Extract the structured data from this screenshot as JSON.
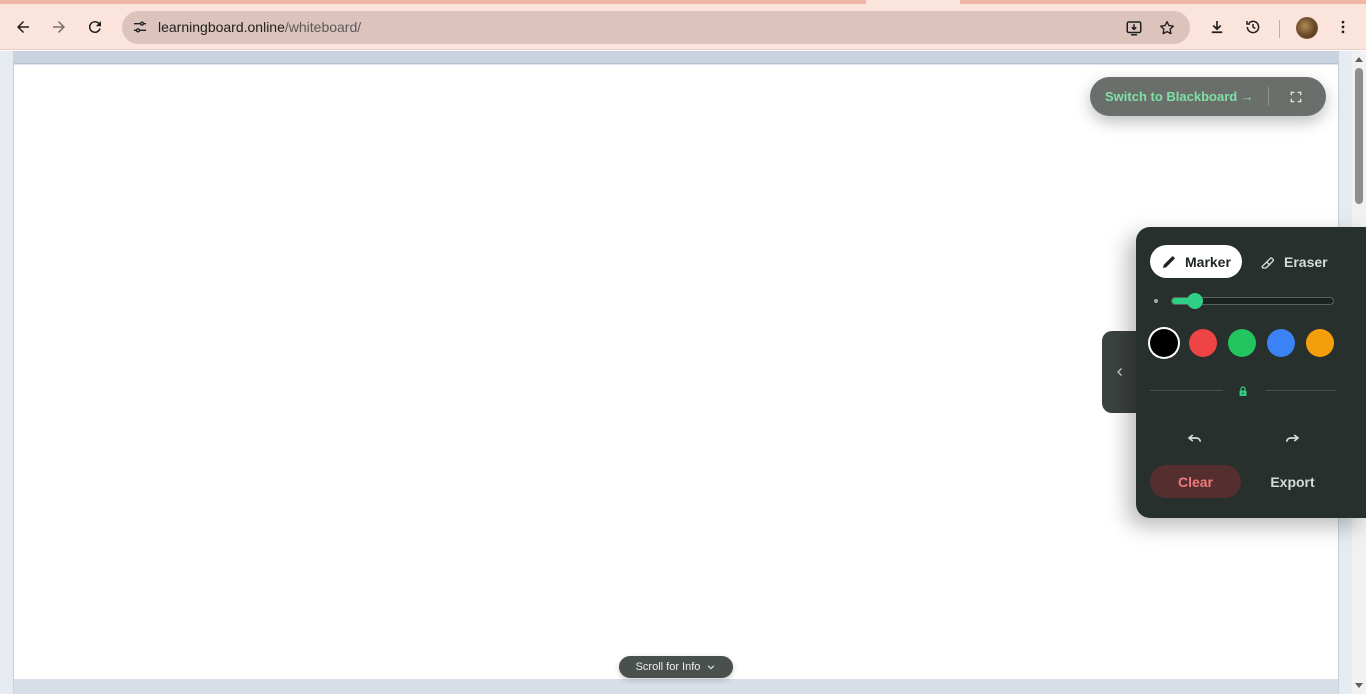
{
  "browser": {
    "url_domain": "learningboard.online",
    "url_path": "/whiteboard/",
    "icons": {
      "back": "back-arrow-icon",
      "forward": "forward-arrow-icon",
      "reload": "reload-icon",
      "site_info": "tune-icon",
      "install": "install-app-icon",
      "bookmark": "star-icon",
      "downloads": "download-icon",
      "history": "history-icon",
      "menu": "kebab-menu-icon"
    }
  },
  "board": {
    "switch_label": "Switch to Blackboard →",
    "scroll_info_label": "Scroll for Info"
  },
  "tools": {
    "marker_label": "Marker",
    "eraser_label": "Eraser",
    "active_tool": "Marker",
    "brush_size_fraction": 0.14,
    "colors": [
      {
        "name": "black",
        "hex": "#000000",
        "selected": true
      },
      {
        "name": "red",
        "hex": "#ef4444",
        "selected": false
      },
      {
        "name": "green",
        "hex": "#22c55e",
        "selected": false
      },
      {
        "name": "blue",
        "hex": "#3b82f6",
        "selected": false
      },
      {
        "name": "orange",
        "hex": "#f59e0b",
        "selected": false
      }
    ],
    "clear_label": "Clear",
    "export_label": "Export"
  },
  "theme": {
    "accent": "#2fcf86",
    "panel_bg": "#27302d",
    "clear_text": "#f07a7d"
  }
}
